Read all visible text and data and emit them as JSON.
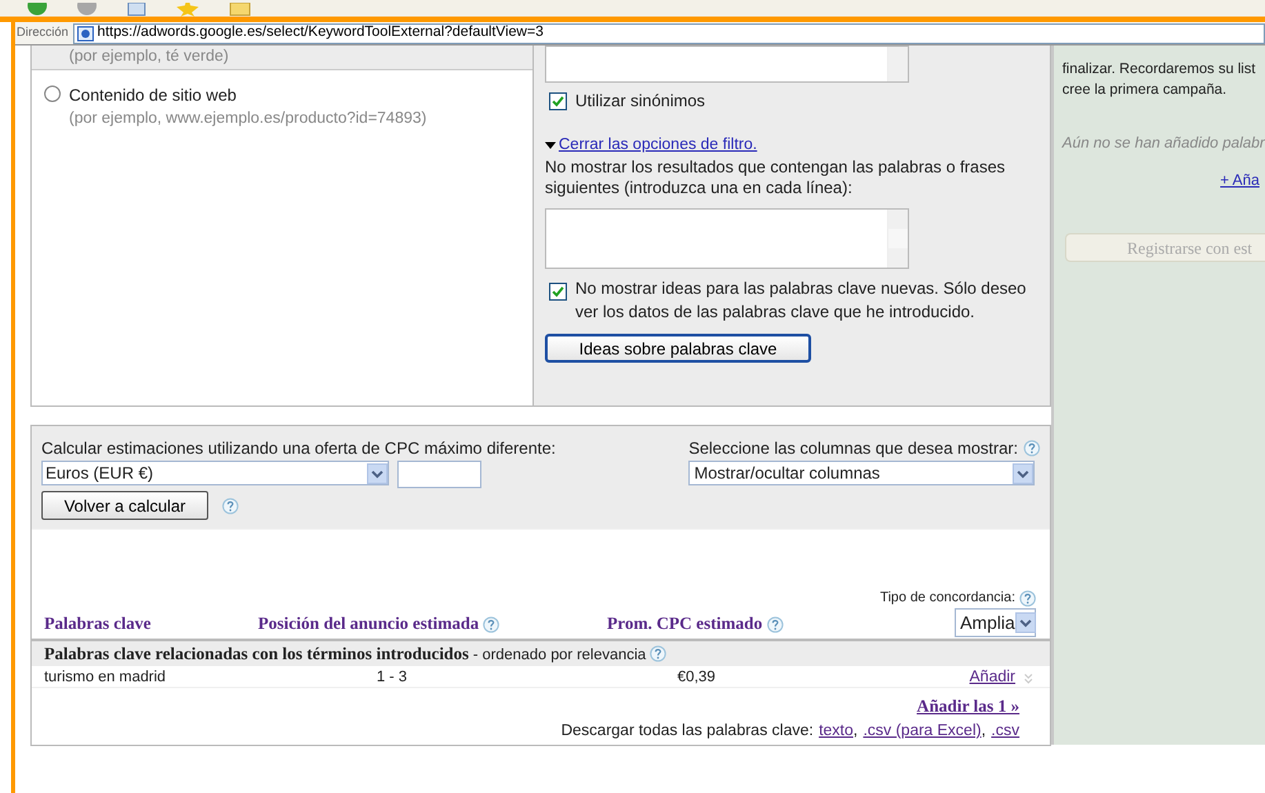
{
  "address_bar": {
    "label": "Dirección",
    "url": "https://adwords.google.es/select/KeywordToolExternal?defaultView=3"
  },
  "keyword_source": {
    "top_hint": "(por ejemplo, té verde)",
    "options": [
      {
        "label": "Contenido de sitio web",
        "hint": "(por ejemplo, www.ejemplo.es/producto?id=74893)",
        "selected": false
      }
    ]
  },
  "filters": {
    "synonyms": {
      "label": "Utilizar sinónimos",
      "checked": true
    },
    "toggle_link": "Cerrar las opciones de filtro.",
    "exclude_text": "No mostrar los resultados que contengan las palabras o frases siguientes (introduzca una en cada línea):",
    "only_entered": {
      "label": "No mostrar ideas para las palabras clave nuevas. Sólo deseo ver los datos de las palabras clave que he introducido.",
      "checked": true
    },
    "submit": "Ideas sobre palabras clave"
  },
  "estimates": {
    "label": "Calcular estimaciones utilizando una oferta de CPC máximo diferente:",
    "currency": "Euros (EUR €)",
    "recalc": "Volver a calcular",
    "columns_label": "Seleccione las columnas que desea mostrar:",
    "columns_select": "Mostrar/ocultar columnas"
  },
  "results": {
    "match_label": "Tipo de concordancia:",
    "match_value": "Amplia",
    "columns": [
      {
        "label": "Palabras clave",
        "help": false
      },
      {
        "label": "Posición del anuncio estimada",
        "help": true
      },
      {
        "label": "Prom. CPC estimado",
        "help": true
      }
    ],
    "group": {
      "title": "Palabras clave relacionadas con los términos introducidos",
      "suffix": " - ordenado por relevancia"
    },
    "rows": [
      {
        "keyword": "turismo en madrid",
        "position": "1 - 3",
        "cpc": "€0,39",
        "action": "Añadir"
      }
    ],
    "add_all": "Añadir las 1 »",
    "download_label": "Descargar todas las palabras clave:",
    "download_separator": ",",
    "download_links": [
      "texto",
      ".csv (para Excel)",
      ".csv"
    ]
  },
  "sidebar": {
    "lines": [
      "finalizar. Recordaremos su list",
      "cree la primera campaña."
    ],
    "empty_note": "Aún no se han añadido palabr",
    "add_link": "+ Aña",
    "register_button": "Registrarse con est",
    "register_disabled": true
  }
}
